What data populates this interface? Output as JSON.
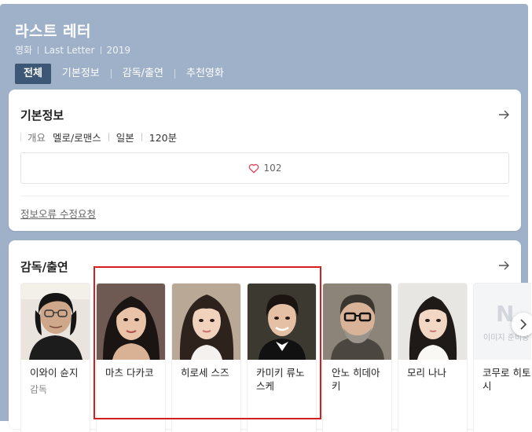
{
  "header": {
    "title": "라스트 레터",
    "meta": [
      "영화",
      "Last Letter",
      "2019"
    ]
  },
  "tabs": [
    {
      "label": "전체",
      "active": true
    },
    {
      "label": "기본정보",
      "active": false
    },
    {
      "label": "감독/출연",
      "active": false
    },
    {
      "label": "추천영화",
      "active": false
    }
  ],
  "basic_info": {
    "heading": "기본정보",
    "overview_label": "개요",
    "genre": "멜로/로맨스",
    "country": "일본",
    "runtime": "120분",
    "like_count": "102",
    "report_link": "정보오류 수정요청"
  },
  "cast": {
    "heading": "감독/출연",
    "people": [
      {
        "name": "이와이 슌지",
        "role": "감독"
      },
      {
        "name": "마츠 다카코",
        "role": ""
      },
      {
        "name": "히로세 스즈",
        "role": ""
      },
      {
        "name": "카미키 류노스케",
        "role": ""
      },
      {
        "name": "안노 히데아키",
        "role": ""
      },
      {
        "name": "모리 나나",
        "role": ""
      },
      {
        "name": "코무로 히토시",
        "role": ""
      }
    ],
    "no_image_text": "이미지 준비중",
    "no_image_logo": "N"
  },
  "colors": {
    "header_bg": "#9fb1c8",
    "active_tab": "#3d5876",
    "highlight": "#d41f1f",
    "heart": "#e0445a"
  },
  "icons": [
    "arrow-right-icon",
    "heart-icon",
    "chevron-right-icon"
  ]
}
